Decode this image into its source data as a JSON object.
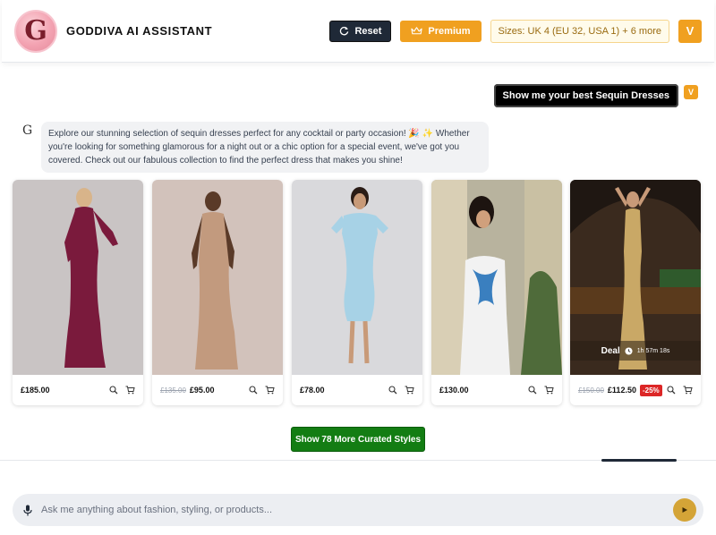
{
  "header": {
    "logo_letter": "G",
    "brand": "GODDIVA AI ASSISTANT",
    "reset_label": "Reset",
    "premium_label": "Premium",
    "sizes_label": "Sizes: UK 4 (EU 32, USA 1) + 6 more",
    "avatar_letter": "V"
  },
  "chat": {
    "user_message": "Show me your best Sequin Dresses",
    "user_avatar": "V",
    "bot_icon": "G",
    "bot_message": "Explore our stunning selection of sequin dresses perfect for any cocktail or party occasion! 🎉 ✨ Whether you're looking for something glamorous for a night out or a chic option for a special event, we've got you covered. Check out our fabulous collection to find the perfect dress that makes you shine!"
  },
  "products": [
    {
      "price": "£185.00",
      "old_price": "",
      "discount": "",
      "deal": false,
      "dress_color": "#7a1a3c",
      "bg": "#c9c4c4"
    },
    {
      "price": "£95.00",
      "old_price": "£135.00",
      "discount": "",
      "deal": false,
      "dress_color": "#c29a7e",
      "bg": "#d2c2bb"
    },
    {
      "price": "£78.00",
      "old_price": "",
      "discount": "",
      "deal": false,
      "dress_color": "#a7d2e6",
      "bg": "#d9d9dc"
    },
    {
      "price": "£130.00",
      "old_price": "",
      "discount": "",
      "deal": false,
      "dress_color": "#f2f2f2",
      "bg": "#b8b39e"
    },
    {
      "price": "£112.50",
      "old_price": "£150.00",
      "discount": "-25%",
      "deal": true,
      "deal_label": "Deal",
      "deal_timer": "1h 57m 18s",
      "dress_color": "#c9a866",
      "bg": "#3a2a1e"
    }
  ],
  "more_button": "Show 78 More Curated Styles",
  "input": {
    "placeholder": "Ask me anything about fashion, styling, or products..."
  },
  "colors": {
    "accent": "#f0a020",
    "more_green": "#137d13",
    "send": "#d4a437",
    "discount": "#dc2626"
  }
}
